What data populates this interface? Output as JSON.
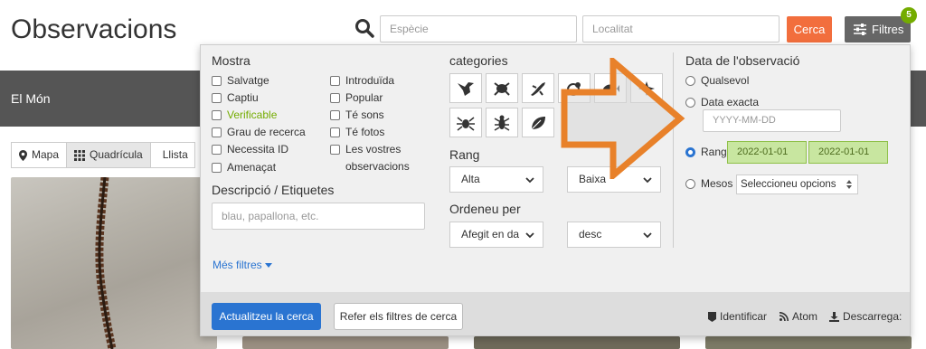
{
  "header": {
    "title": "Observacions",
    "species_placeholder": "Espècie",
    "place_placeholder": "Localitat",
    "search_button": "Cerca",
    "filters_button": "Filtres",
    "filters_count": "5"
  },
  "band": {
    "place": "El Món"
  },
  "view_tabs": [
    {
      "label": "Mapa",
      "icon": "map-marker-icon"
    },
    {
      "label": "Quadrícula",
      "icon": "grid-icon"
    },
    {
      "label": "Llista",
      "icon": "list-icon"
    }
  ],
  "panel": {
    "mostra": {
      "title": "Mostra",
      "col1": [
        "Salvatge",
        "Captiu",
        "Verificable",
        "Grau de recerca",
        "Necessita ID",
        "Amenaçat"
      ],
      "col2": [
        "Introduïda",
        "Popular",
        "Té sons",
        "Té fotos",
        "Les vostres observacions"
      ],
      "highlight_color": "#74ac00"
    },
    "description": {
      "title": "Descripció / Etiquetes",
      "placeholder": "blau, papallona, etc."
    },
    "more_filters": "Més filtres",
    "categories": {
      "title": "categories",
      "icons": [
        "bird-icon",
        "amphibian-icon",
        "reptile-icon",
        "mammal-icon",
        "fish-icon",
        "mollusk-icon",
        "arachnid-icon",
        "insect-icon",
        "leaf-icon"
      ]
    },
    "rang": {
      "title": "Rang",
      "high": "Alta",
      "low": "Baixa"
    },
    "order": {
      "title": "Ordeneu per",
      "by": "Afegit en da",
      "dir": "desc"
    },
    "date": {
      "title": "Data de l'observació",
      "any": "Qualsevol",
      "exact": "Data exacta",
      "exact_placeholder": "YYYY-MM-DD",
      "range": "Rang",
      "range_from": "2022-01-01",
      "range_to": "2022-01-01",
      "months": "Mesos",
      "months_select": "Seleccioneu opcions"
    },
    "footer": {
      "update": "Actualitzeu la cerca",
      "reset": "Refer els filtres de cerca",
      "identify": "Identificar",
      "atom": "Atom",
      "download": "Descarrega:"
    }
  },
  "colors": {
    "accent": "#f26e3d",
    "primary": "#2a74d1",
    "arrow": "#e8812a"
  }
}
